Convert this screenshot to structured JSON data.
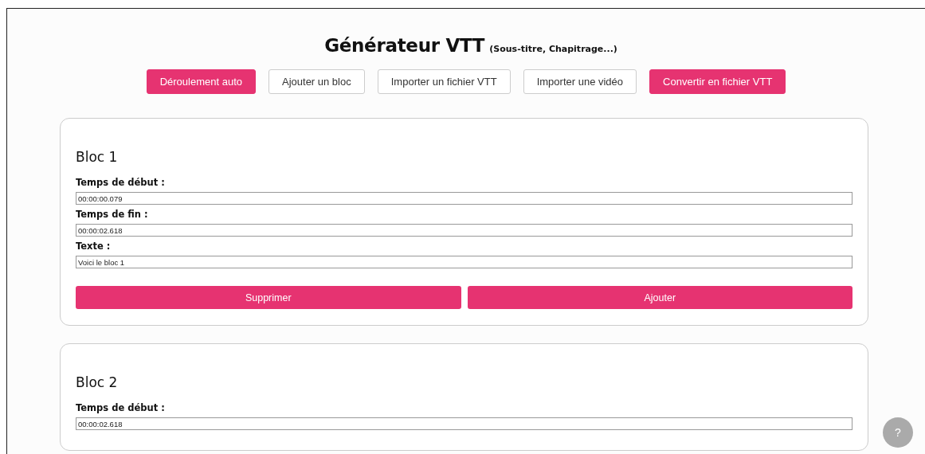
{
  "header": {
    "title": "Générateur VTT",
    "subtitle": "(Sous-titre, Chapitrage...)"
  },
  "toolbar": [
    {
      "label": "Déroulement auto",
      "kind": "primary"
    },
    {
      "label": "Ajouter un bloc",
      "kind": "secondary"
    },
    {
      "label": "Importer un fichier VTT",
      "kind": "secondary"
    },
    {
      "label": "Importer une vidéo",
      "kind": "secondary"
    },
    {
      "label": "Convertir en fichier VTT",
      "kind": "primary"
    }
  ],
  "blocks": [
    {
      "title": "Bloc 1",
      "fields": [
        {
          "label": "Temps de début :",
          "value": "00:00:00.079"
        },
        {
          "label": "Temps de fin :",
          "value": "00:00:02.618"
        },
        {
          "label": "Texte :",
          "value": "Voici le bloc 1"
        }
      ],
      "actions": [
        "Supprimer",
        "Ajouter"
      ]
    },
    {
      "title": "Bloc 2",
      "fields": [
        {
          "label": "Temps de début :",
          "value": "00:00:02.618"
        }
      ]
    }
  ],
  "help_button": {
    "label": "?"
  }
}
